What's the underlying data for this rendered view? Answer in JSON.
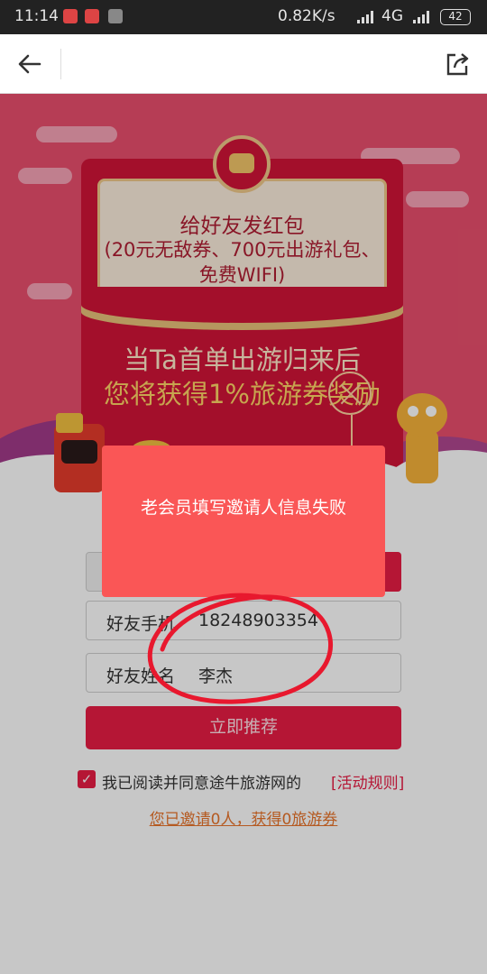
{
  "status_bar": {
    "time": "11:14",
    "network_speed": "0.82K/s",
    "network_type": "4G",
    "battery": "42"
  },
  "nav": {
    "back_icon": "arrow-left-icon",
    "share_icon": "share-icon"
  },
  "banner": {
    "letter_title": "给好友发红包",
    "letter_sub_1": "(20元无敌券、700元出游礼包、",
    "letter_sub_2": "免费WIFI)",
    "reward_line_1": "当Ta首单出游归来后",
    "reward_line_2": "您将获得1%旅游券奖励"
  },
  "form": {
    "phone_label": "好友手机",
    "phone_value": "18248903354",
    "name_label": "好友姓名",
    "name_value": "李杰",
    "submit_label": "立即推荐"
  },
  "agreement": {
    "checkbox_mark": "✓",
    "text": "我已阅读并同意途牛旅游网的",
    "rules_link": "[活动规则]"
  },
  "invite_summary": "您已邀请0人，获得0旅游券",
  "toast": {
    "message": "老会员填写邀请人信息失败"
  },
  "colors": {
    "brand_red": "#e81d45",
    "toast_red": "#fa5656",
    "link_orange": "#e8742b"
  }
}
